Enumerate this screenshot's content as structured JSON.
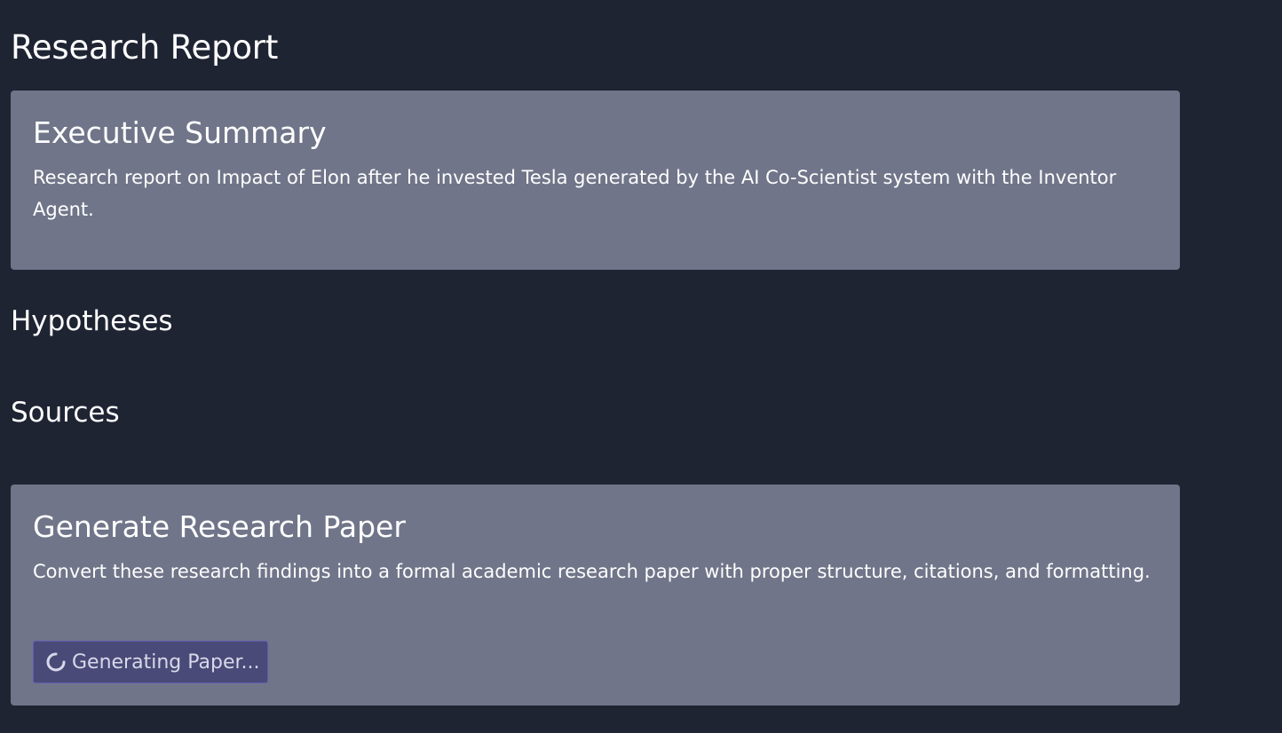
{
  "report": {
    "title": "Research Report"
  },
  "executive_summary": {
    "title": "Executive Summary",
    "text": "Research report on Impact of Elon after he invested Tesla generated by the AI Co-Scientist system with the Inventor Agent."
  },
  "sections": {
    "hypotheses_title": "Hypotheses",
    "sources_title": "Sources"
  },
  "generate_paper": {
    "title": "Generate Research Paper",
    "text": "Convert these research findings into a formal academic research paper with proper structure, citations, and formatting.",
    "button_label": "Generating Paper...",
    "button_icon": "loading-spinner-icon"
  },
  "colors": {
    "background": "#1f2433",
    "card": "#707589",
    "button": "#4a4a78",
    "button_border": "#5f5bb1",
    "button_text": "#d8d8ea"
  }
}
